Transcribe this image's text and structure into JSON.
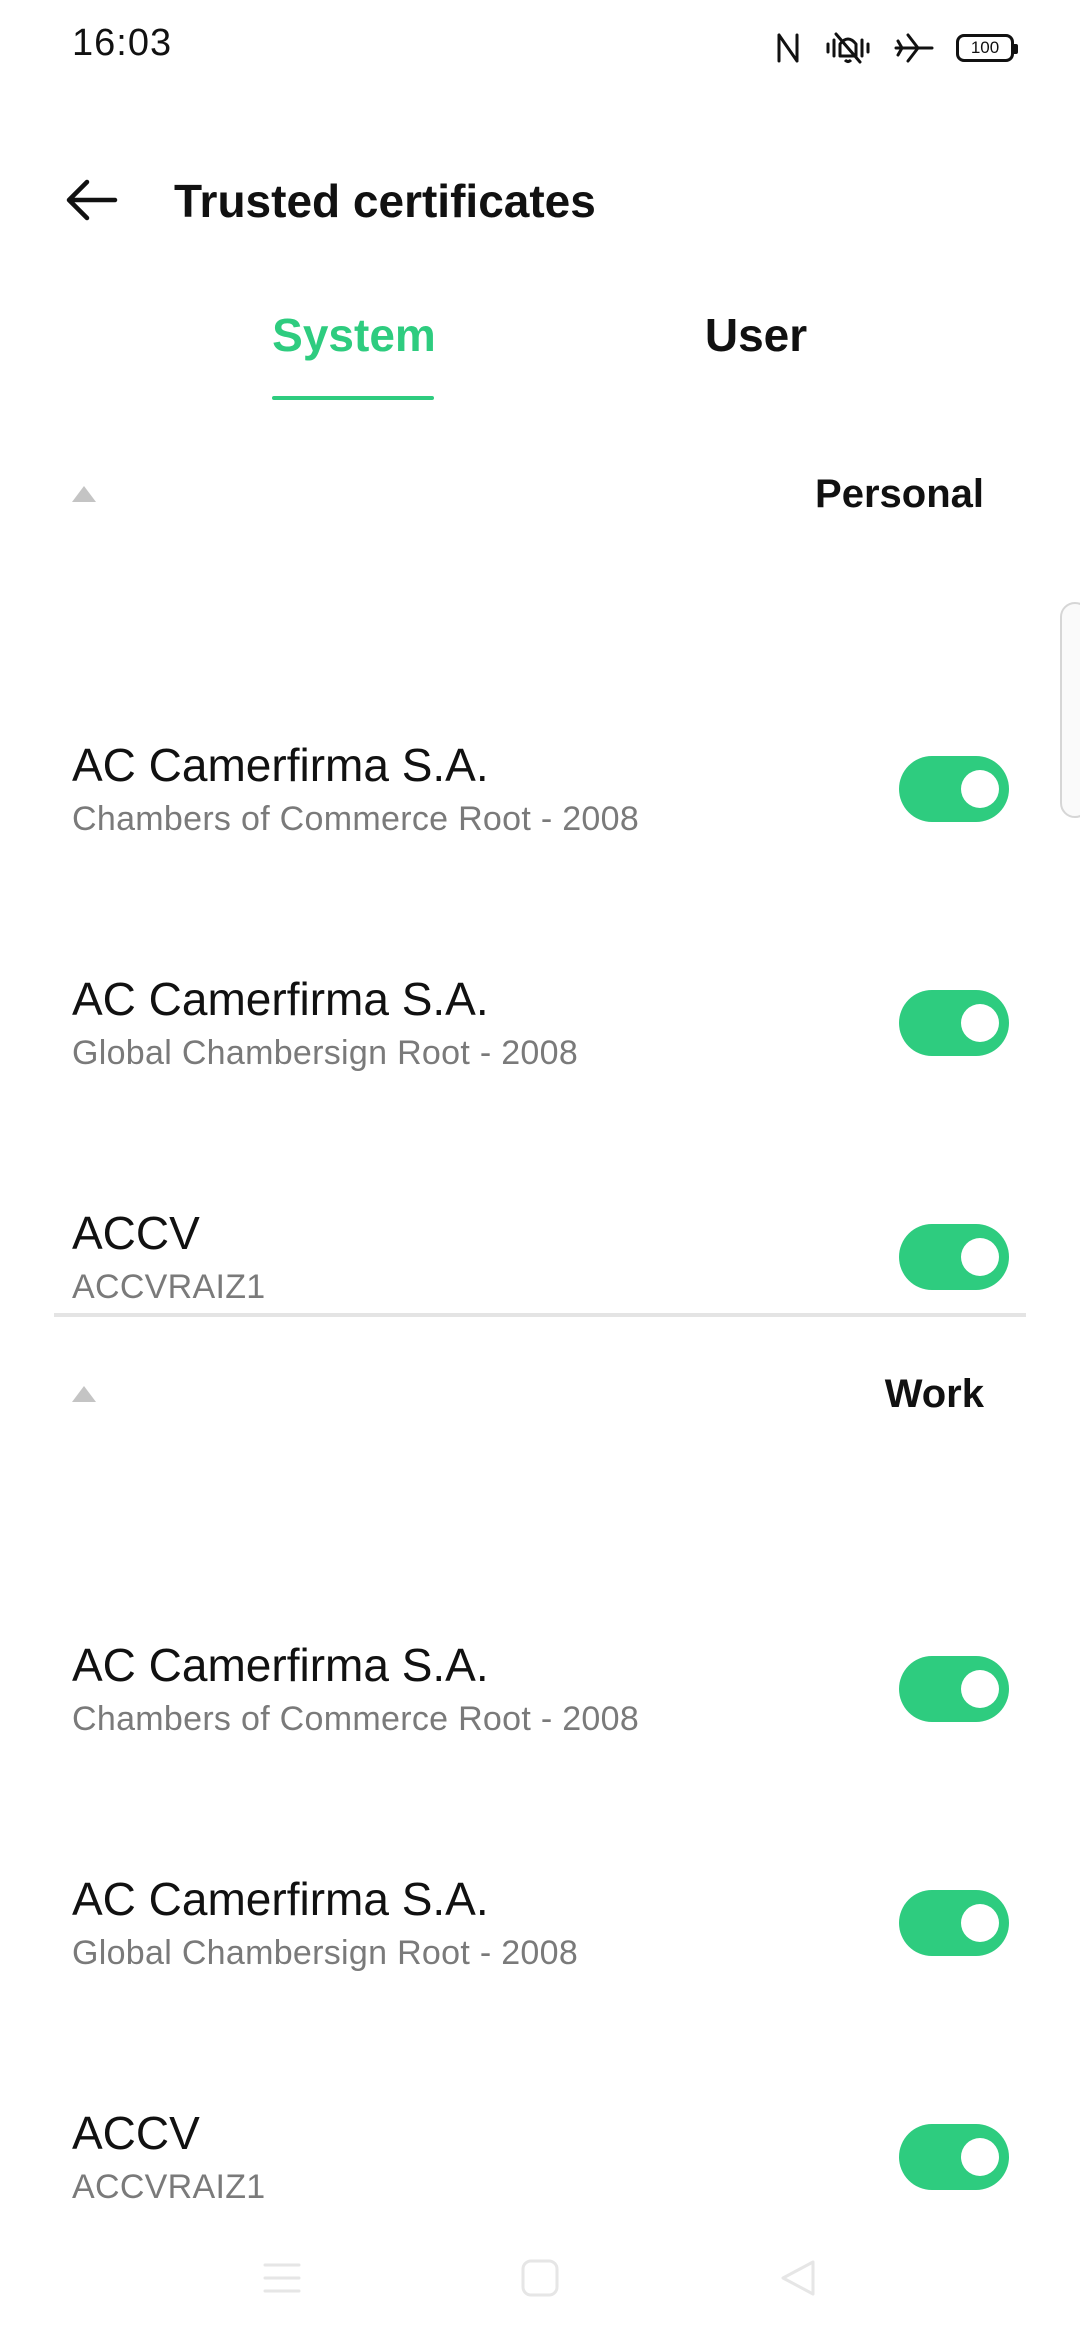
{
  "status_bar": {
    "time": "16:03",
    "battery_level": "100",
    "icons": [
      "nfc-icon",
      "vibrate-silent-icon",
      "airplane-mode-icon",
      "battery-icon"
    ]
  },
  "app_bar": {
    "back_icon": "arrow-left-icon",
    "title": "Trusted certificates"
  },
  "tabs": [
    {
      "label": "System",
      "selected": true
    },
    {
      "label": "User",
      "selected": false
    }
  ],
  "colors": {
    "accent": "#2ecc7f",
    "subtitle_gray": "#7a7a7a",
    "divider": "#e4e4e4"
  },
  "sections": [
    {
      "label": "Personal",
      "items": [
        {
          "title": "AC Camerfirma S.A.",
          "subtitle": "Chambers of Commerce Root - 2008",
          "enabled": true
        },
        {
          "title": "AC Camerfirma S.A.",
          "subtitle": "Global Chambersign Root - 2008",
          "enabled": true
        },
        {
          "title": "ACCV",
          "subtitle": "ACCVRAIZ1",
          "enabled": true
        }
      ]
    },
    {
      "label": "Work",
      "items": [
        {
          "title": "AC Camerfirma S.A.",
          "subtitle": "Chambers of Commerce Root - 2008",
          "enabled": true
        },
        {
          "title": "AC Camerfirma S.A.",
          "subtitle": "Global Chambersign Root - 2008",
          "enabled": true
        },
        {
          "title": "ACCV",
          "subtitle": "ACCVRAIZ1",
          "enabled": true
        }
      ]
    }
  ],
  "nav_bar": {
    "icons": [
      "menu-icon",
      "home-icon",
      "back-triangle-icon"
    ]
  }
}
